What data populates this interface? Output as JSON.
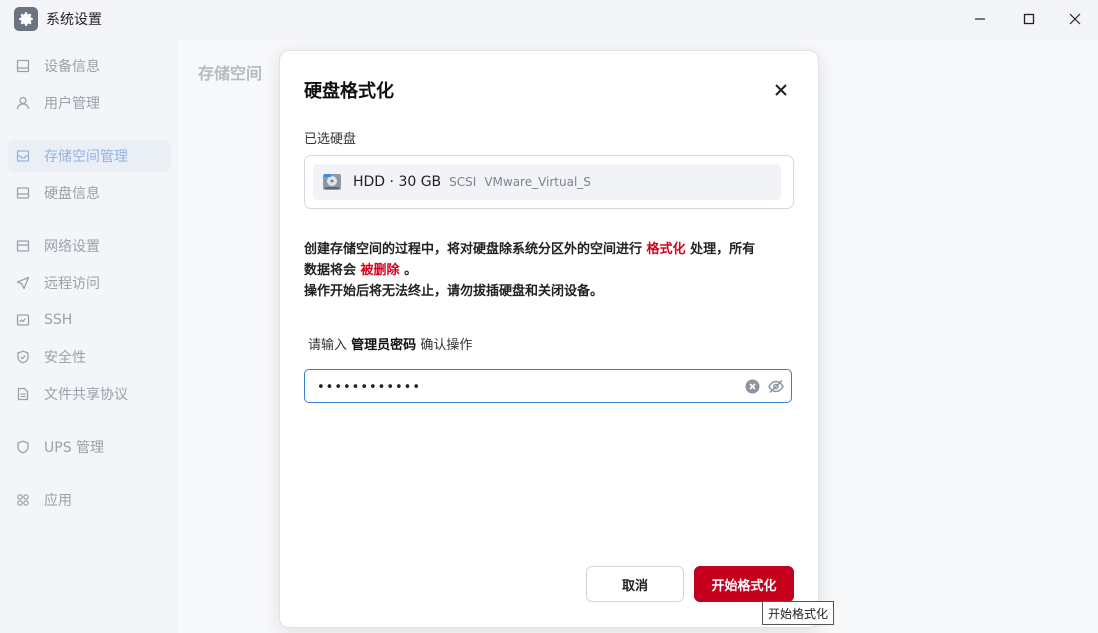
{
  "window": {
    "title": "系统设置"
  },
  "sidebar": {
    "items": [
      {
        "label": "设备信息",
        "icon": "device-icon"
      },
      {
        "label": "用户管理",
        "icon": "user-icon"
      },
      {
        "label": "存储空间管理",
        "icon": "storage-icon",
        "active": true
      },
      {
        "label": "硬盘信息",
        "icon": "disk-icon"
      },
      {
        "label": "网络设置",
        "icon": "network-icon"
      },
      {
        "label": "远程访问",
        "icon": "send-icon"
      },
      {
        "label": "SSH",
        "icon": "terminal-icon"
      },
      {
        "label": "安全性",
        "icon": "shield-icon"
      },
      {
        "label": "文件共享协议",
        "icon": "file-icon"
      },
      {
        "label": "UPS 管理",
        "icon": "ups-icon"
      },
      {
        "label": "应用",
        "icon": "apps-icon"
      }
    ]
  },
  "main": {
    "title": "存储空间"
  },
  "dialog": {
    "title": "硬盘格式化",
    "selected_label": "已选硬盘",
    "disk": {
      "name": "HDD · 30 GB",
      "bus": "SCSI",
      "model": "VMware_Virtual_S"
    },
    "warning": {
      "line1_a": "创建存储空间的过程中，将对硬盘除系统分区外的空间进行",
      "line1_red": "格式化",
      "line1_b": "处理，所有",
      "line2_a": "数据将会",
      "line2_red": "被删除",
      "line2_b": "。",
      "line3": "操作开始后将无法终止，请勿拔插硬盘和关闭设备。"
    },
    "password": {
      "label_a": "请输入",
      "label_bold": "管理员密码",
      "label_b": "确认操作",
      "value": "••••••••••••"
    },
    "cancel_label": "取消",
    "start_label": "开始格式化",
    "tooltip": "开始格式化"
  },
  "colors": {
    "danger": "#c4001d",
    "accent": "#3a7fd6"
  }
}
